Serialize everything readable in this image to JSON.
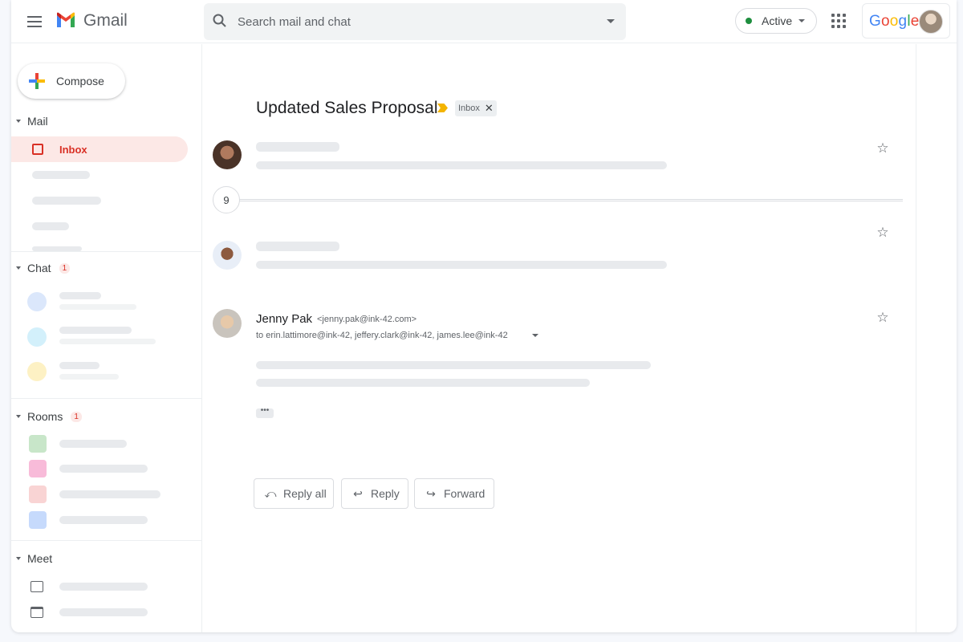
{
  "app": {
    "name": "Gmail"
  },
  "search": {
    "placeholder": "Search mail and chat"
  },
  "status": {
    "label": "Active",
    "color": "#1e8e3e"
  },
  "account": {
    "brand": "Google"
  },
  "compose": {
    "label": "Compose"
  },
  "sidebar": {
    "mail": {
      "header": "Mail",
      "inbox_label": "Inbox"
    },
    "chat": {
      "header": "Chat",
      "badge": "1"
    },
    "rooms": {
      "header": "Rooms",
      "badge": "1"
    },
    "meet": {
      "header": "Meet"
    }
  },
  "thread": {
    "subject": "Updated Sales Proposal",
    "label_chip": "Inbox",
    "collapsed_count": "9",
    "open_message": {
      "sender_name": "Jenny Pak",
      "sender_email": "<jenny.pak@ink-42.com>",
      "recipients": "to erin.lattimore@ink-42, jeffery.clark@ink-42, james.lee@ink-42"
    },
    "actions": {
      "reply_all": "Reply all",
      "reply": "Reply",
      "forward": "Forward"
    }
  },
  "colors": {
    "accent": "#d93025",
    "inbox_bg": "#fce8e6",
    "importance": "#f4b400"
  },
  "icons": [
    "menu-icon",
    "gmail-logo-icon",
    "search-icon",
    "apps-grid-icon",
    "compose-plus-icon",
    "inbox-icon",
    "star-icon",
    "reply-all-icon",
    "reply-icon",
    "forward-icon",
    "video-call-icon",
    "calendar-icon"
  ]
}
